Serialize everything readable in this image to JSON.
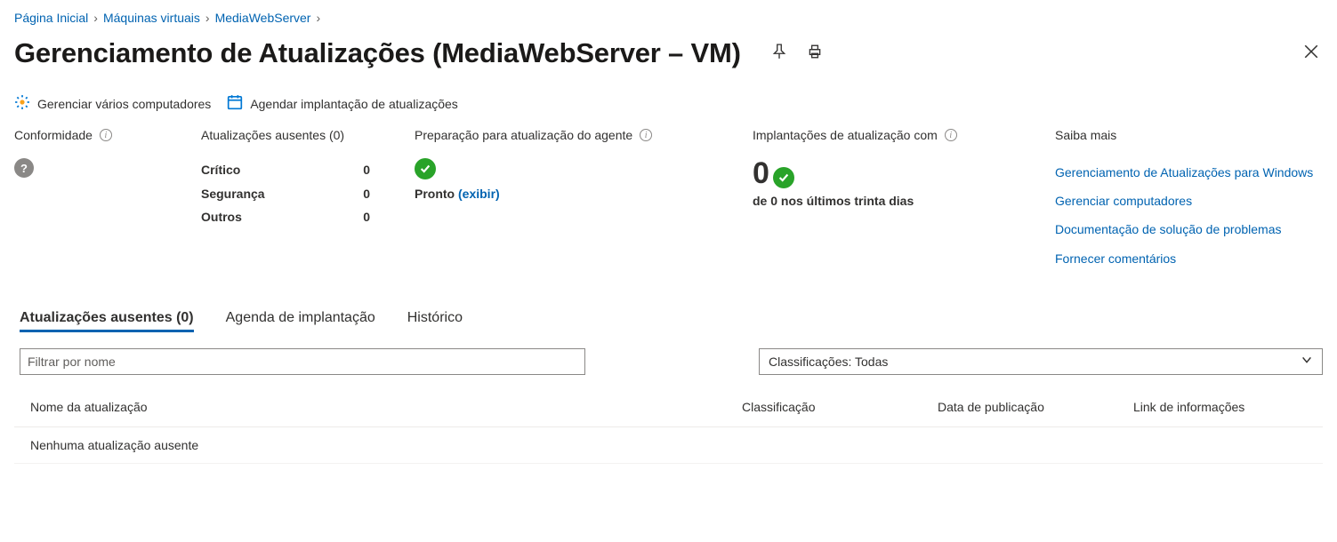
{
  "breadcrumb": {
    "home": "Página Inicial",
    "vms": "Máquinas virtuais",
    "vm_name": "MediaWebServer"
  },
  "title": "Gerenciamento de Atualizações (MediaWebServer – VM)",
  "toolbar": {
    "manage_multi": "Gerenciar vários computadores",
    "schedule": "Agendar implantação de atualizações"
  },
  "summary": {
    "compliance": {
      "label": "Conformidade"
    },
    "missing": {
      "label": "Atualizações ausentes (0)",
      "critical_label": "Crítico",
      "critical_value": "0",
      "security_label": "Segurança",
      "security_value": "0",
      "others_label": "Outros",
      "others_value": "0"
    },
    "agent": {
      "label": "Preparação para atualização do agente",
      "ready": "Pronto",
      "view": "(exibir)"
    },
    "deployments": {
      "label": "Implantações de atualização com",
      "value": "0",
      "subtext": "de 0 nos últimos trinta dias"
    },
    "learn": {
      "label": "Saiba mais",
      "link1": "Gerenciamento de Atualizações para Windows",
      "link2": "Gerenciar computadores",
      "link3": "Documentação de solução de problemas",
      "link4": "Fornecer comentários"
    }
  },
  "tabs": {
    "missing": "Atualizações ausentes (0)",
    "schedule": "Agenda de implantação",
    "history": "Histórico"
  },
  "filter": {
    "placeholder": "Filtrar por nome",
    "select_label": "Classificações: Todas"
  },
  "table": {
    "col_name": "Nome da atualização",
    "col_class": "Classificação",
    "col_date": "Data de publicação",
    "col_link": "Link de informações",
    "empty": "Nenhuma atualização ausente"
  }
}
